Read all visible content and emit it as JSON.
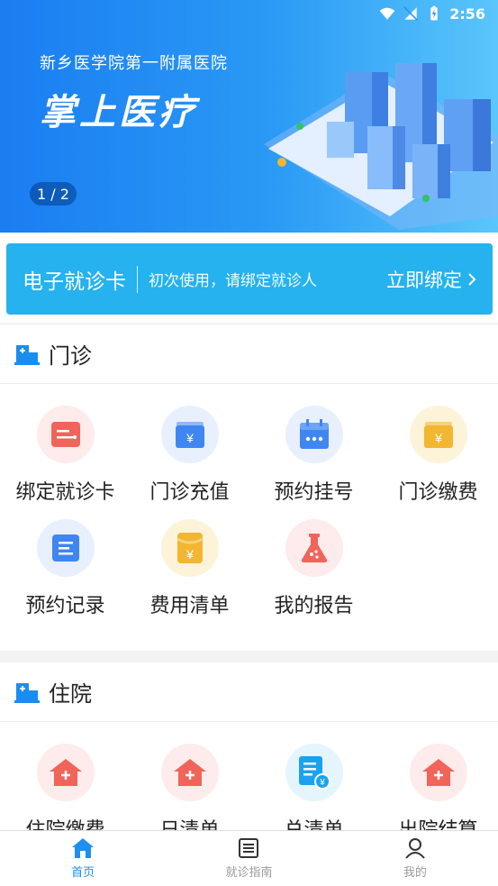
{
  "status_bar": {
    "time": "2:56"
  },
  "banner": {
    "hospital": "新乡医学院第一附属医院",
    "slogan": "掌上医疗",
    "pager": "1 / 2"
  },
  "bind_card": {
    "title": "电子就诊卡",
    "hint": "初次使用，请绑定就诊人",
    "action": "立即绑定"
  },
  "outpatient": {
    "title": "门诊",
    "items": [
      {
        "label": "绑定就诊卡",
        "icon": "card-icon",
        "color": "#f0645a"
      },
      {
        "label": "门诊充值",
        "icon": "wallet-icon",
        "color": "#3f86f1"
      },
      {
        "label": "预约挂号",
        "icon": "calendar-icon",
        "color": "#3f86f1"
      },
      {
        "label": "门诊缴费",
        "icon": "wallet-yuan-icon",
        "color": "#f2b631"
      },
      {
        "label": "预约记录",
        "icon": "list-icon",
        "color": "#3f86f1"
      },
      {
        "label": "费用清单",
        "icon": "envelope-yuan-icon",
        "color": "#f2b631"
      },
      {
        "label": "我的报告",
        "icon": "flask-icon",
        "color": "#f0645a"
      }
    ]
  },
  "inpatient": {
    "title": "住院",
    "items": [
      {
        "label": "住院缴费",
        "icon": "hospital-house-icon",
        "color": "#f0645a"
      },
      {
        "label": "日清单",
        "icon": "hospital-house-icon",
        "color": "#f0645a"
      },
      {
        "label": "总清单",
        "icon": "bill-list-icon",
        "color": "#1aa2f0"
      },
      {
        "label": "出院结算",
        "icon": "hospital-house-icon",
        "color": "#f0645a"
      }
    ]
  },
  "tabbar": {
    "home": "首页",
    "guide": "就诊指南",
    "mine": "我的"
  }
}
